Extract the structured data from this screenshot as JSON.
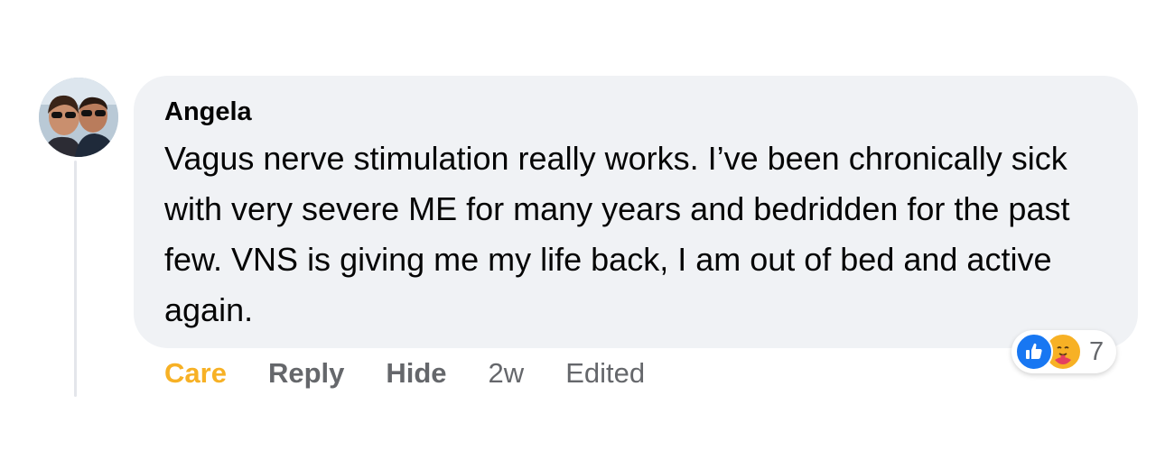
{
  "comment": {
    "author": "Angela",
    "text": "Vagus nerve stimulation really works. I’ve been chronically sick with very severe ME for many years and bedridden for the past few. VNS is giving me my life back, I am out of bed and active again.",
    "actions": {
      "care_label": "Care",
      "reply_label": "Reply",
      "hide_label": "Hide",
      "time": "2w",
      "edited_label": "Edited"
    },
    "reactions": {
      "icons": [
        "like-icon",
        "care-icon"
      ],
      "count": "7"
    }
  },
  "colors": {
    "bubble": "#f0f2f5",
    "care_reaction": "#f7b125",
    "like_blue": "#1877f2",
    "meta_gray": "#65676b"
  }
}
